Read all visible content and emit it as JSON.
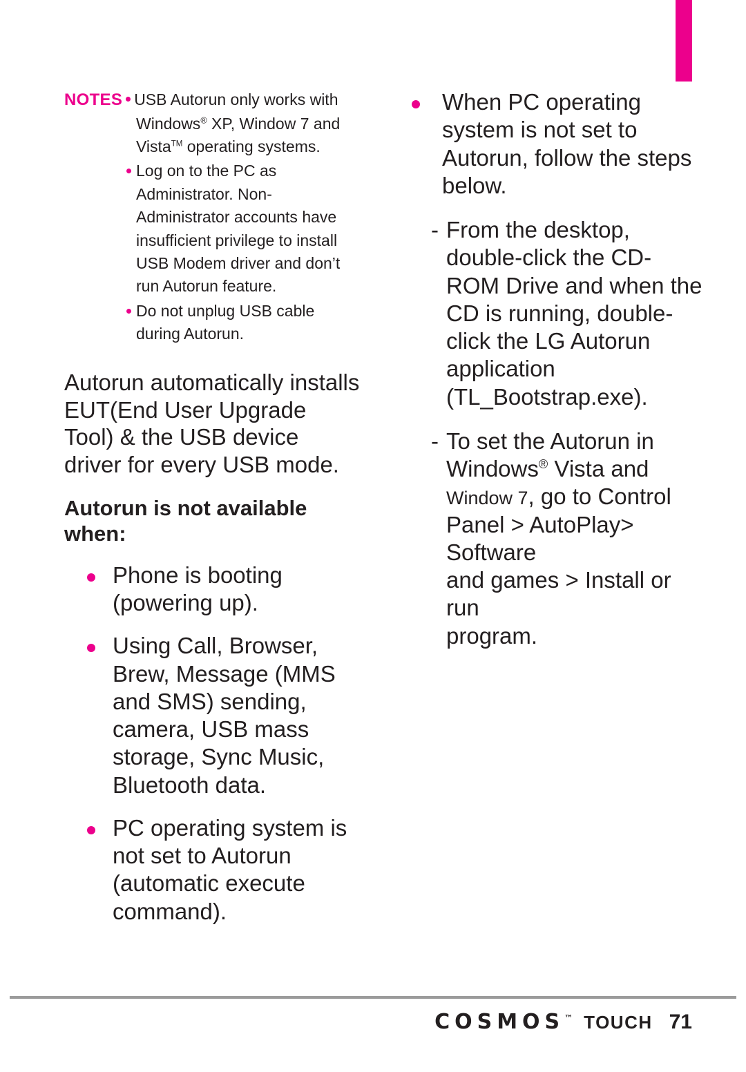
{
  "page": {
    "number": "71",
    "brand": "COSMOS",
    "brand_tm": "™",
    "product": "TOUCH",
    "accent_color": "#ec008c",
    "text_color": "#231f20"
  },
  "notes": {
    "label": "NOTES",
    "first_item": "USB Autorun only works with Windows",
    "first_item_sup": "®",
    "first_item_cont": " XP, Window 7 and Vista",
    "first_item_sup2": "TM",
    "first_item_end": " operating systems.",
    "items": [
      "Log on to the PC as Administrator. Non-Administrator accounts have insufficient privilege to install USB Modem driver and don’t run Autorun feature.",
      "Do not unplug USB cable during Autorun."
    ]
  },
  "left": {
    "paragraph": "Autorun automatically installs EUT(End User Upgrade Tool) & the USB device driver for every USB mode.",
    "subhead": "Autorun is not available when:",
    "bullets": [
      "Phone is booting (powering up).",
      "Using Call, Browser, Brew, Message (MMS and SMS) sending, camera, USB mass storage, Sync Music, Bluetooth data.",
      "PC operating system is not set to Autorun (automatic execute command)."
    ]
  },
  "right": {
    "bullet": "When  PC operating system is not set to Autorun, follow the steps below.",
    "dash_items": [
      {
        "text": "From the desktop, double-click the CD-ROM Drive and when the CD is running, double-click the LG Autorun application (TL_Bootstrap.exe)."
      }
    ],
    "dash2": {
      "line1": "To set the Autorun in",
      "line2_pre": "Windows",
      "line2_sup": "®",
      "line2_post": " Vista and",
      "line3_small": "Window 7",
      "line3_rest": ", go to Control",
      "line4": "Panel > AutoPlay> Software",
      "line5": "and games > Install or run",
      "line6": "program."
    }
  }
}
